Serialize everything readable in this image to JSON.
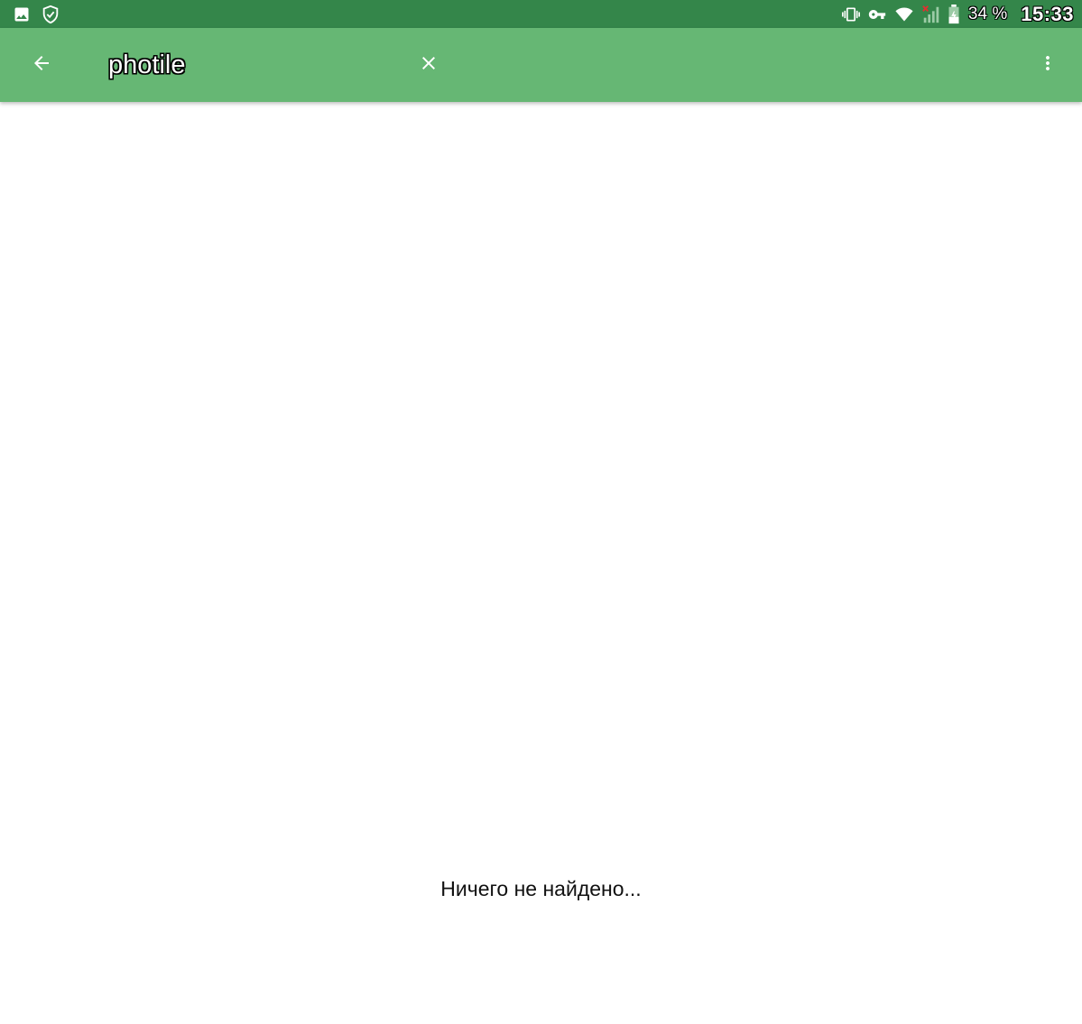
{
  "status_bar": {
    "left_icons": [
      "image-icon",
      "shield-check-icon"
    ],
    "right_icons": [
      "vibrate-icon",
      "vpn-key-icon",
      "wifi-icon",
      "cell-signal-no-service-icon",
      "battery-icon"
    ],
    "battery_percent": "34 %",
    "clock": "15:33",
    "background_color": "#34864a"
  },
  "app_bar": {
    "background_color": "#66b774",
    "back_icon": "arrow-left-icon",
    "search_query": "photile",
    "clear_icon": "close-icon",
    "menu_icon": "more-vert-icon"
  },
  "content": {
    "empty_message": "Ничего не найдено..."
  }
}
